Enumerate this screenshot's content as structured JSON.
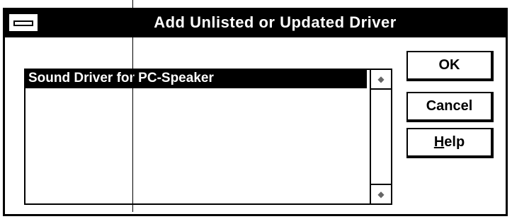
{
  "window": {
    "title": "Add Unlisted or Updated Driver"
  },
  "listbox": {
    "items": [
      {
        "label": "Sound Driver for PC-Speaker",
        "selected": true
      }
    ]
  },
  "buttons": {
    "ok": "OK",
    "cancel": "Cancel",
    "help_mnemonic": "H",
    "help_rest": "elp"
  },
  "icons": {
    "system_menu": "system-menu-icon",
    "scroll_up": "scroll-up-arrow-icon",
    "scroll_down": "scroll-down-arrow-icon"
  }
}
